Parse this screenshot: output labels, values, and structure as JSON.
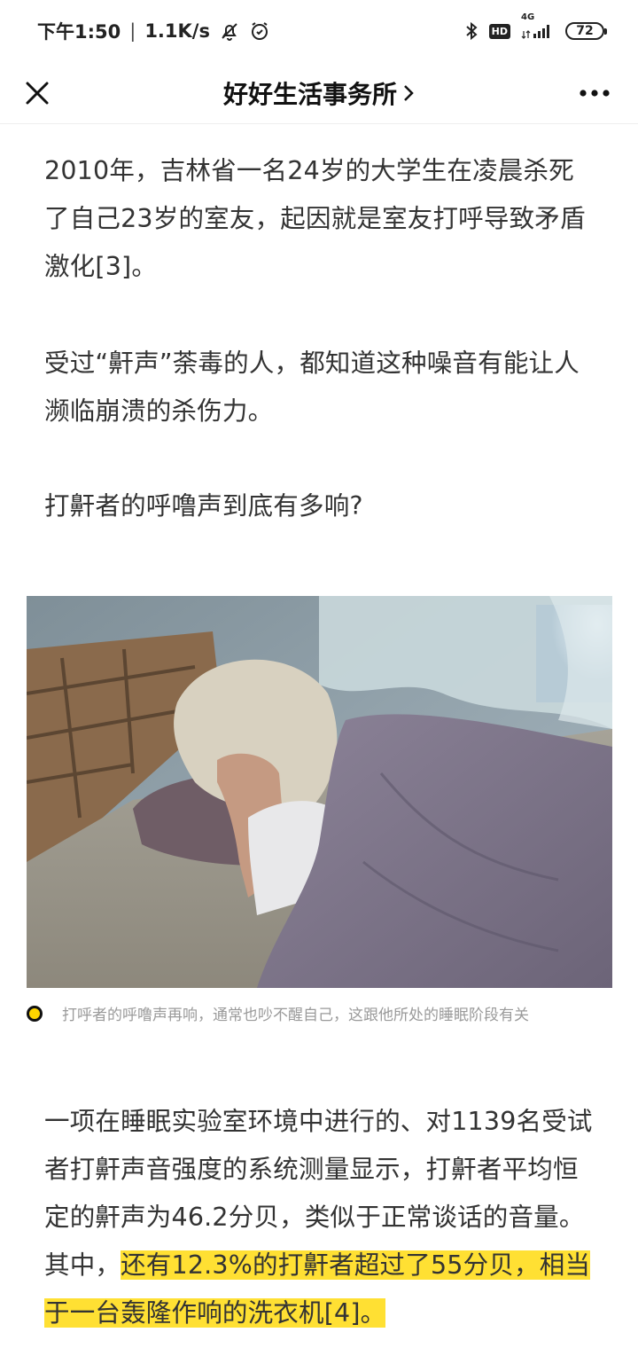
{
  "status_bar": {
    "time": "下午1:50",
    "separator": "|",
    "net_speed": "1.1K/s",
    "network": "4G",
    "hd": "HD",
    "battery": "72",
    "icons": [
      "mute-bell-icon",
      "alarm-icon",
      "bluetooth-icon",
      "signal-icon"
    ]
  },
  "nav": {
    "title": "好好生活事务所",
    "title_chevron": "›",
    "icons": [
      "close-icon",
      "more-icon",
      "chevron-right-icon"
    ]
  },
  "article": {
    "paragraph1": "2010年，吉林省一名24岁的大学生在凌晨杀死了自己23岁的室友，起因就是室友打呼导致矛盾激化[3]。",
    "paragraph2": "受过“鼾声”荼毒的人，都知道这种噪音有能让人濒临崩溃的杀伤力。",
    "paragraph3": "打鼾者的呼噜声到底有多响?",
    "image_caption": "打呼者的呼噜声再响，通常也吵不醒自己，这跟他所处的睡眠阶段有关",
    "paragraph4_plain": "一项在睡眠实验室环境中进行的、对1139名受试者打鼾声音强度的系统测量显示，打鼾者平均恒定的鼾声为46.2分贝，类似于正常谈话的音量。其中，",
    "paragraph4_highlight": "还有12.3%的打鼾者超过了55分贝，相当于一台轰隆作响的洗衣机[4]。"
  },
  "colors": {
    "highlight": "#ffe033",
    "caption_dot": "#ffd600",
    "text": "#333333",
    "caption_text": "#9a9a9a"
  }
}
